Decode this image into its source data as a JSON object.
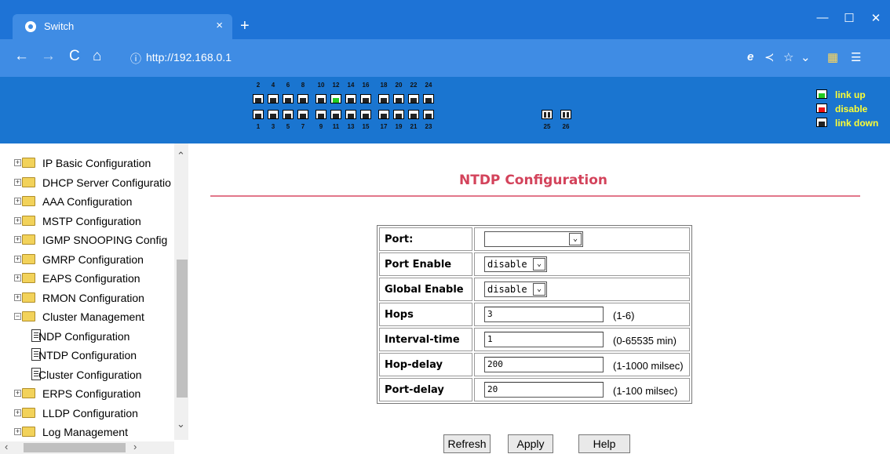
{
  "browser": {
    "tab_title": "Switch",
    "tab_close": "×",
    "new_tab": "+",
    "url": "http://192.168.0.1",
    "minimize": "—",
    "maximize": "☐",
    "close": "✕"
  },
  "ports": {
    "top_numbers": [
      "2",
      "4",
      "6",
      "8",
      "10",
      "12",
      "14",
      "16",
      "18",
      "20",
      "22",
      "24"
    ],
    "bottom_numbers": [
      "1",
      "3",
      "5",
      "7",
      "9",
      "11",
      "13",
      "15",
      "17",
      "19",
      "21",
      "23"
    ],
    "sfp_numbers": [
      "25",
      "26"
    ],
    "link_up_port": "12",
    "legend": [
      "link up",
      "disable",
      "link down"
    ]
  },
  "sidebar": {
    "items": [
      {
        "label": "IP Basic Configuration",
        "type": "folder"
      },
      {
        "label": "DHCP Server Configuratio",
        "type": "folder"
      },
      {
        "label": "AAA Configuration",
        "type": "folder"
      },
      {
        "label": "MSTP Configuration",
        "type": "folder"
      },
      {
        "label": "IGMP SNOOPING Config",
        "type": "folder"
      },
      {
        "label": "GMRP Configuration",
        "type": "folder"
      },
      {
        "label": "EAPS Configuration",
        "type": "folder"
      },
      {
        "label": "RMON Configuration",
        "type": "folder"
      },
      {
        "label": "Cluster Management",
        "type": "folder-open"
      },
      {
        "label": "NDP Configuration",
        "type": "doc"
      },
      {
        "label": "NTDP Configuration",
        "type": "doc"
      },
      {
        "label": "Cluster Configuration",
        "type": "doc"
      },
      {
        "label": "ERPS Configuration",
        "type": "folder"
      },
      {
        "label": "LLDP Configuration",
        "type": "folder"
      },
      {
        "label": "Log Management",
        "type": "folder"
      }
    ]
  },
  "form": {
    "title": "NTDP Configuration",
    "rows": [
      {
        "label": "Port:",
        "kind": "select",
        "value": ""
      },
      {
        "label": "Port Enable",
        "kind": "select",
        "value": "disable"
      },
      {
        "label": "Global Enable",
        "kind": "select",
        "value": "disable"
      },
      {
        "label": "Hops",
        "kind": "text",
        "value": "3",
        "range": "(1-6)"
      },
      {
        "label": "Interval-time",
        "kind": "text",
        "value": "1",
        "range": "(0-65535 min)"
      },
      {
        "label": "Hop-delay",
        "kind": "text",
        "value": "200",
        "range": "(1-1000 milsec)"
      },
      {
        "label": "Port-delay",
        "kind": "text",
        "value": "20",
        "range": "(1-100 milsec)"
      }
    ],
    "buttons": {
      "refresh": "Refresh",
      "apply": "Apply",
      "help": "Help"
    }
  },
  "colors": {
    "chrome_blue": "#1e73d6",
    "banner_blue": "#1a75d0",
    "title_red": "#d3435b",
    "legend_yellow": "#ffff33"
  }
}
